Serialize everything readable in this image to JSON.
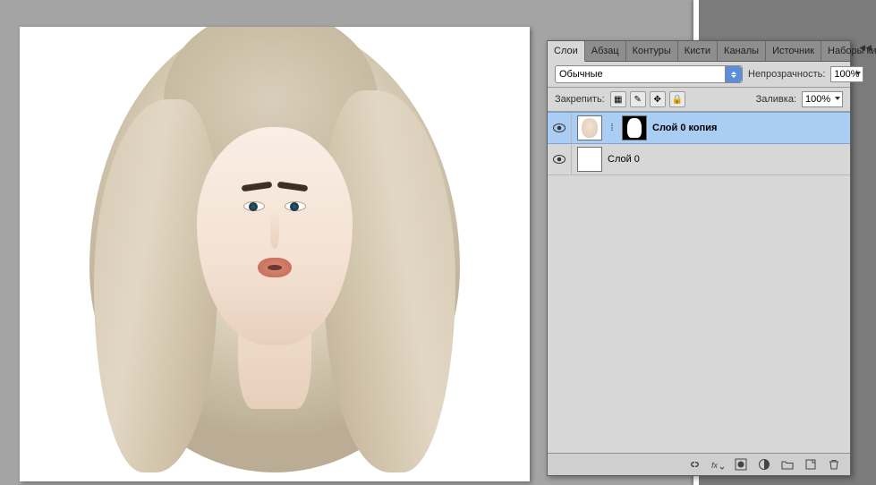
{
  "tabs": {
    "items": [
      "Слои",
      "Абзац",
      "Контуры",
      "Кисти",
      "Каналы",
      "Источник",
      "Наборы ки"
    ],
    "active_index": 0
  },
  "blend": {
    "mode": "Обычные",
    "opacity_label": "Непрозрачность:",
    "opacity_value": "100%"
  },
  "lock": {
    "label": "Закрепить:",
    "fill_label": "Заливка:",
    "fill_value": "100%"
  },
  "layers": [
    {
      "name": "Слой 0 копия",
      "visible": true,
      "selected": true,
      "has_mask": true
    },
    {
      "name": "Слой 0",
      "visible": true,
      "selected": false,
      "has_mask": false
    }
  ],
  "icons": {
    "lock_trans": "▦",
    "lock_pixels": "✎",
    "lock_move": "✥",
    "lock_all": "🔒",
    "menu": "≡"
  }
}
